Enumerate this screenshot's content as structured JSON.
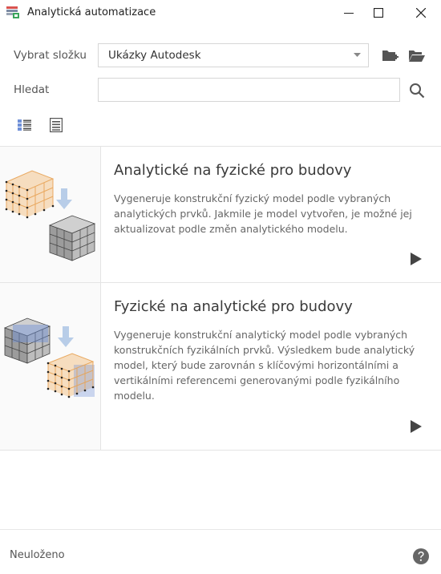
{
  "window": {
    "title": "Analytická automatizace"
  },
  "form": {
    "folder_label": "Vybrat složku",
    "folder_value": "Ukázky Autodesk",
    "search_label": "Hledat",
    "search_value": ""
  },
  "items": [
    {
      "title": "Analytické na fyzické pro budovy",
      "description": "Vygeneruje konstrukční fyzický model podle vybraných analytických prvků. Jakmile je model vytvořen, je možné jej aktualizovat podle změn analytického modelu."
    },
    {
      "title": "Fyzické na analytické pro budovy",
      "description": "Vygeneruje konstrukční analytický model podle vybraných konstrukčních fyzikálních prvků. Výsledkem bude analytický model, který bude zarovnán s klíčovými horizontálními a vertikálními referencemi generovanými podle fyzikálního modelu."
    }
  ],
  "footer": {
    "status": "Neuloženo"
  },
  "colors": {
    "accent_orange": "#e8a355",
    "accent_blue": "#6f90d8",
    "icon_gray": "#555555"
  }
}
